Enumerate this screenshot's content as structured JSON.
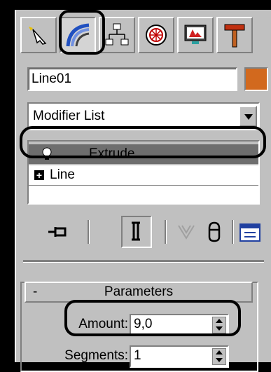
{
  "command_panel": {
    "tabs": [
      {
        "name": "create",
        "icon": "star-cursor-icon"
      },
      {
        "name": "modify",
        "icon": "curve-bend-icon",
        "active": true
      },
      {
        "name": "hierarchy",
        "icon": "hierarchy-icon"
      },
      {
        "name": "motion",
        "icon": "wheel-icon"
      },
      {
        "name": "display",
        "icon": "monitor-icon"
      },
      {
        "name": "utilities",
        "icon": "hammer-icon"
      }
    ]
  },
  "object": {
    "name": "Line01",
    "color": "#d2691e"
  },
  "modifier_list": {
    "selected": "Modifier List"
  },
  "modifier_stack": {
    "items": [
      {
        "label": "Extrude",
        "selected": true,
        "icon": "lightbulb-icon"
      },
      {
        "label": "Line",
        "expand": "+"
      }
    ]
  },
  "stack_toolbar": {
    "icons": [
      "pin-stack-icon",
      "show-end-result-icon",
      "make-unique-icon",
      "remove-modifier-icon",
      "configure-sets-icon"
    ]
  },
  "parameters": {
    "title": "Parameters",
    "collapse_symbol": "-",
    "amount_label": "Amount:",
    "amount_value": "9,0",
    "segments_label": "Segments:",
    "segments_value": "1"
  }
}
